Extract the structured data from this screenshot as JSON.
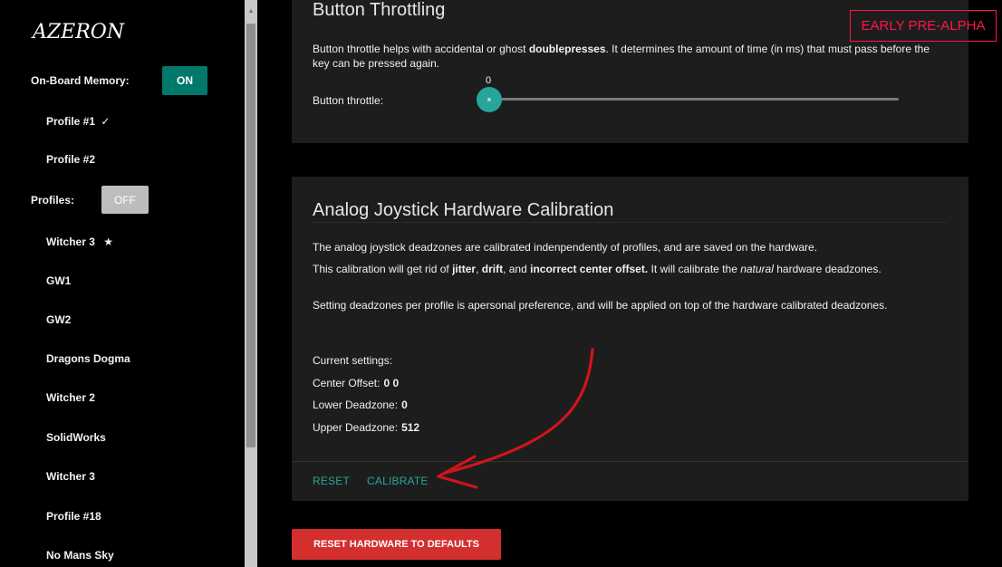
{
  "sidebar": {
    "logo_text": "AZERON",
    "onboard_label": "On-Board Memory:",
    "onboard_toggle": "ON",
    "onboard_items": [
      {
        "label": "Profile #1",
        "mark": "✓"
      },
      {
        "label": "Profile #2",
        "mark": ""
      }
    ],
    "profiles_label": "Profiles:",
    "profiles_toggle": "OFF",
    "profile_items": [
      {
        "label": "Witcher 3",
        "mark": "★"
      },
      {
        "label": "GW1",
        "mark": ""
      },
      {
        "label": "GW2",
        "mark": ""
      },
      {
        "label": "Dragons Dogma",
        "mark": ""
      },
      {
        "label": "Witcher 2",
        "mark": ""
      },
      {
        "label": "SolidWorks",
        "mark": ""
      },
      {
        "label": "Witcher 3",
        "mark": ""
      },
      {
        "label": "Profile #18",
        "mark": ""
      },
      {
        "label": "No Mans Sky",
        "mark": ""
      }
    ]
  },
  "badge": "EARLY PRE-ALPHA",
  "throttle": {
    "title": "Button Throttling",
    "desc_pre": "Button throttle helps with accidental or ghost ",
    "desc_bold": "doublepresses",
    "desc_post": ". It determines the amount of time (in ms) that must pass before the key can be pressed again.",
    "label": "Button throttle:",
    "value": "0",
    "fraction": 0
  },
  "calibration": {
    "title": "Analog Joystick Hardware Calibration",
    "p1": "The analog joystick deadzones are calibrated indenpendently of profiles, and are saved on the hardware.",
    "p2_a": "This calibration will get rid of ",
    "p2_b1": "jitter",
    "p2_c": ", ",
    "p2_b2": "drift",
    "p2_d": ", and ",
    "p2_b3": "incorrect center offset.",
    "p2_e": " It will calibrate the ",
    "p2_i": "natural",
    "p2_f": " hardware deadzones.",
    "p3": "Setting deadzones per profile is apersonal preference, and will be applied on top of the hardware calibrated deadzones.",
    "current_label": "Current settings:",
    "center_label": "Center Offset:",
    "center_value": "0 0",
    "lower_label": "Lower Deadzone:",
    "lower_value": "0",
    "upper_label": "Upper Deadzone:",
    "upper_value": "512",
    "reset_label": "RESET",
    "calibrate_label": "CALIBRATE"
  },
  "reset_hw_label": "RESET HARDWARE TO DEFAULTS",
  "colors": {
    "accent": "#26a69a",
    "toggle_on": "#00796b",
    "danger": "#d32f2f",
    "badge": "#ff1744",
    "annotation_arrow": "#d0141b"
  }
}
